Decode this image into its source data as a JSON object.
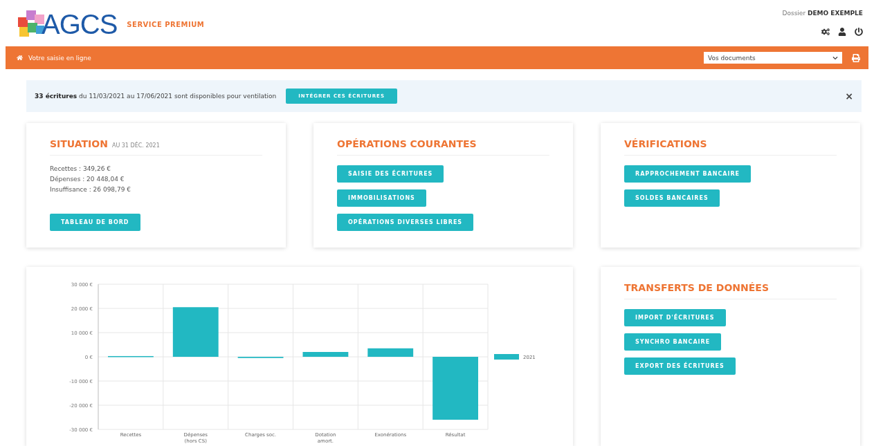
{
  "header": {
    "logo_text": "AGCS",
    "tagline": "SERVICE PREMIUM",
    "dossier_label": "Dossier",
    "dossier_name": "DEMO EXEMPLE"
  },
  "nav": {
    "title": "Votre saisie en ligne",
    "documents_select": "Vos documents"
  },
  "alert": {
    "count": "33 écritures",
    "message": "du 11/03/2021 au 17/06/2021 sont disponibles pour ventilation",
    "button": "INTÉGRER CES ÉCRITURES",
    "close": "×"
  },
  "cards": [
    {
      "title": "SITUATION",
      "subtitle": "AU 31 DÉC. 2021",
      "lines": [
        "Recettes : 349,26 €",
        "Dépenses : 20 448,04 €",
        "Insuffisance : 26 098,79 €"
      ],
      "buttons": [
        "TABLEAU DE BORD"
      ]
    },
    {
      "title": "OPÉRATIONS COURANTES",
      "buttons": [
        "SAISIE DES ÉCRITURES",
        "IMMOBILISATIONS",
        "OPÉRATIONS DIVERSES LIBRES"
      ]
    },
    {
      "title": "VÉRIFICATIONS",
      "buttons": [
        "RAPPROCHEMENT BANCAIRE",
        "SOLDES BANCAIRES"
      ]
    }
  ],
  "chart": {
    "chart_data": {
      "type": "bar",
      "categories": [
        "Recettes",
        "Dépenses (hors CS)",
        "Charges soc.",
        "Dotation amort.",
        "Exonérations",
        "Résultat"
      ],
      "series": [
        {
          "name": "2021",
          "color": "#22b8c2",
          "values": [
            300,
            20500,
            -500,
            2000,
            3500,
            -26000
          ]
        }
      ],
      "grid": true,
      "ylim": [
        -30000,
        30000
      ],
      "yticks": [
        {
          "value": 30000,
          "label": "30 000 €"
        },
        {
          "value": 20000,
          "label": "20 000 €"
        },
        {
          "value": 10000,
          "label": "10 000 €"
        },
        {
          "value": 0,
          "label": "0 €"
        },
        {
          "value": -10000,
          "label": "-10 000 €"
        },
        {
          "value": -20000,
          "label": "-20 000 €"
        },
        {
          "value": -30000,
          "label": "-30 000 €"
        }
      ]
    }
  },
  "transfers": {
    "title": "TRANSFERTS DE DONNÉES",
    "buttons": [
      "IMPORT D'ÉCRITURES",
      "SYNCHRO BANCAIRE",
      "EXPORT DES ÉCRITURES"
    ]
  }
}
